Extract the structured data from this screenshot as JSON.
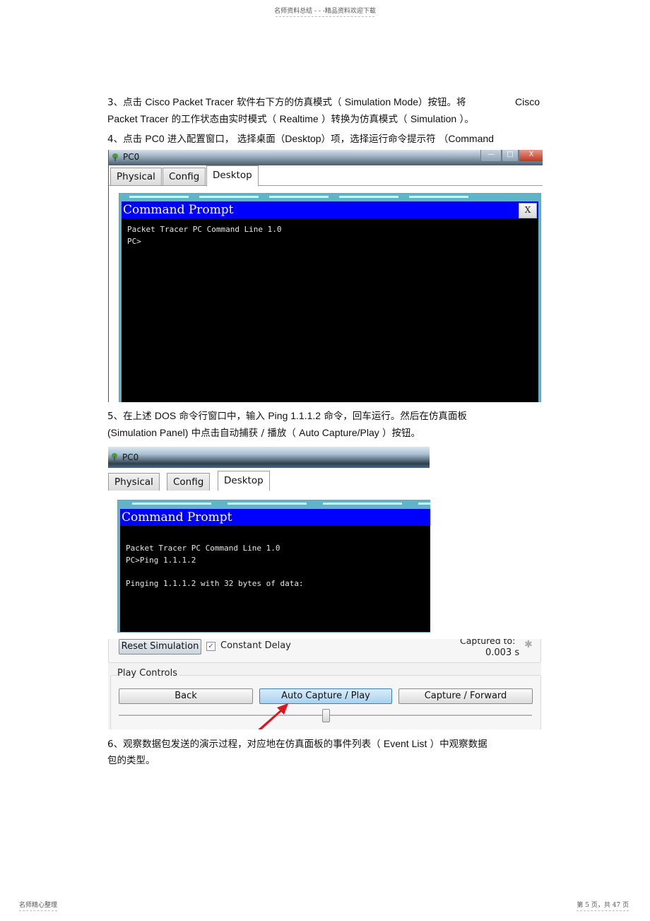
{
  "header": {
    "text": "名师资料总结 - - -精品资料欢迎下载"
  },
  "paragraphs": {
    "p3_line1": [
      "3、点击 ",
      "Cisco  Packet  Tracer",
      "  软件右下方的仿真模式（  ",
      "Simulation  Mode",
      "）按钮。将  ",
      "Cisco"
    ],
    "p3_line2": [
      "Packet Tracer",
      "   的工作状态由实时模式（  ",
      "Realtime",
      "  ）转换为仿真模式（  ",
      "Simulation",
      "  ）。"
    ],
    "p4": [
      "4、点击  ",
      "PC0",
      "  进入配置窗口，  选择桌面（",
      "Desktop",
      "）项，选择运行命令提示符  （",
      "Command Prompt",
      "）。"
    ],
    "p5_line1": [
      "5、在上述  ",
      "DOS",
      " 命令行窗口中，输入   ",
      "Ping 1.1.1.2",
      "     命令，回车运行。然后在仿真面板"
    ],
    "p5_line2": [
      "(Simulation Panel)",
      "      中点击自动捕获  / 播放（ ",
      "Auto Capture/Play",
      "   ）按钮。"
    ],
    "p6_line1": [
      "6、观察数据包发送的演示过程，对应地在仿真面板的事件列表（         ",
      "Event List",
      "   ）中观察数据"
    ],
    "p6_line2": [
      "包的类型。"
    ]
  },
  "window1": {
    "title": "PC0",
    "tabs": [
      "Physical",
      "Config",
      "Desktop"
    ],
    "active_tab": "Desktop",
    "controls": {
      "minimize": "—",
      "maximize": "□",
      "close": "X"
    },
    "cmd": {
      "title": "Command Prompt",
      "close_label": "X",
      "lines": [
        "Packet Tracer PC Command Line 1.0",
        "PC>"
      ]
    }
  },
  "window2": {
    "title": "PC0",
    "tabs": [
      "Physical",
      "Config",
      "Desktop"
    ],
    "active_tab": "Desktop",
    "cmd": {
      "title": "Command Prompt",
      "lines": [
        "Packet Tracer PC Command Line 1.0",
        "PC>Ping 1.1.1.2",
        "",
        "Pinging 1.1.1.2 with 32 bytes of data:"
      ]
    }
  },
  "simulation_panel": {
    "reset_label": "Reset Simulation",
    "constant_delay_label": "Constant Delay",
    "constant_delay_checked": true,
    "captured_to_label": "Captured to:",
    "captured_to_value": "0.003 s",
    "play_controls_label": "Play Controls",
    "buttons": {
      "back": "Back",
      "auto_capture": "Auto Capture / Play",
      "capture_forward": "Capture / Forward"
    },
    "speed_slider_fraction": 0.5,
    "accent_color": "#e0141b"
  },
  "footer": {
    "left": "名师精心整理",
    "right": "第 5 页，共 47 页"
  }
}
